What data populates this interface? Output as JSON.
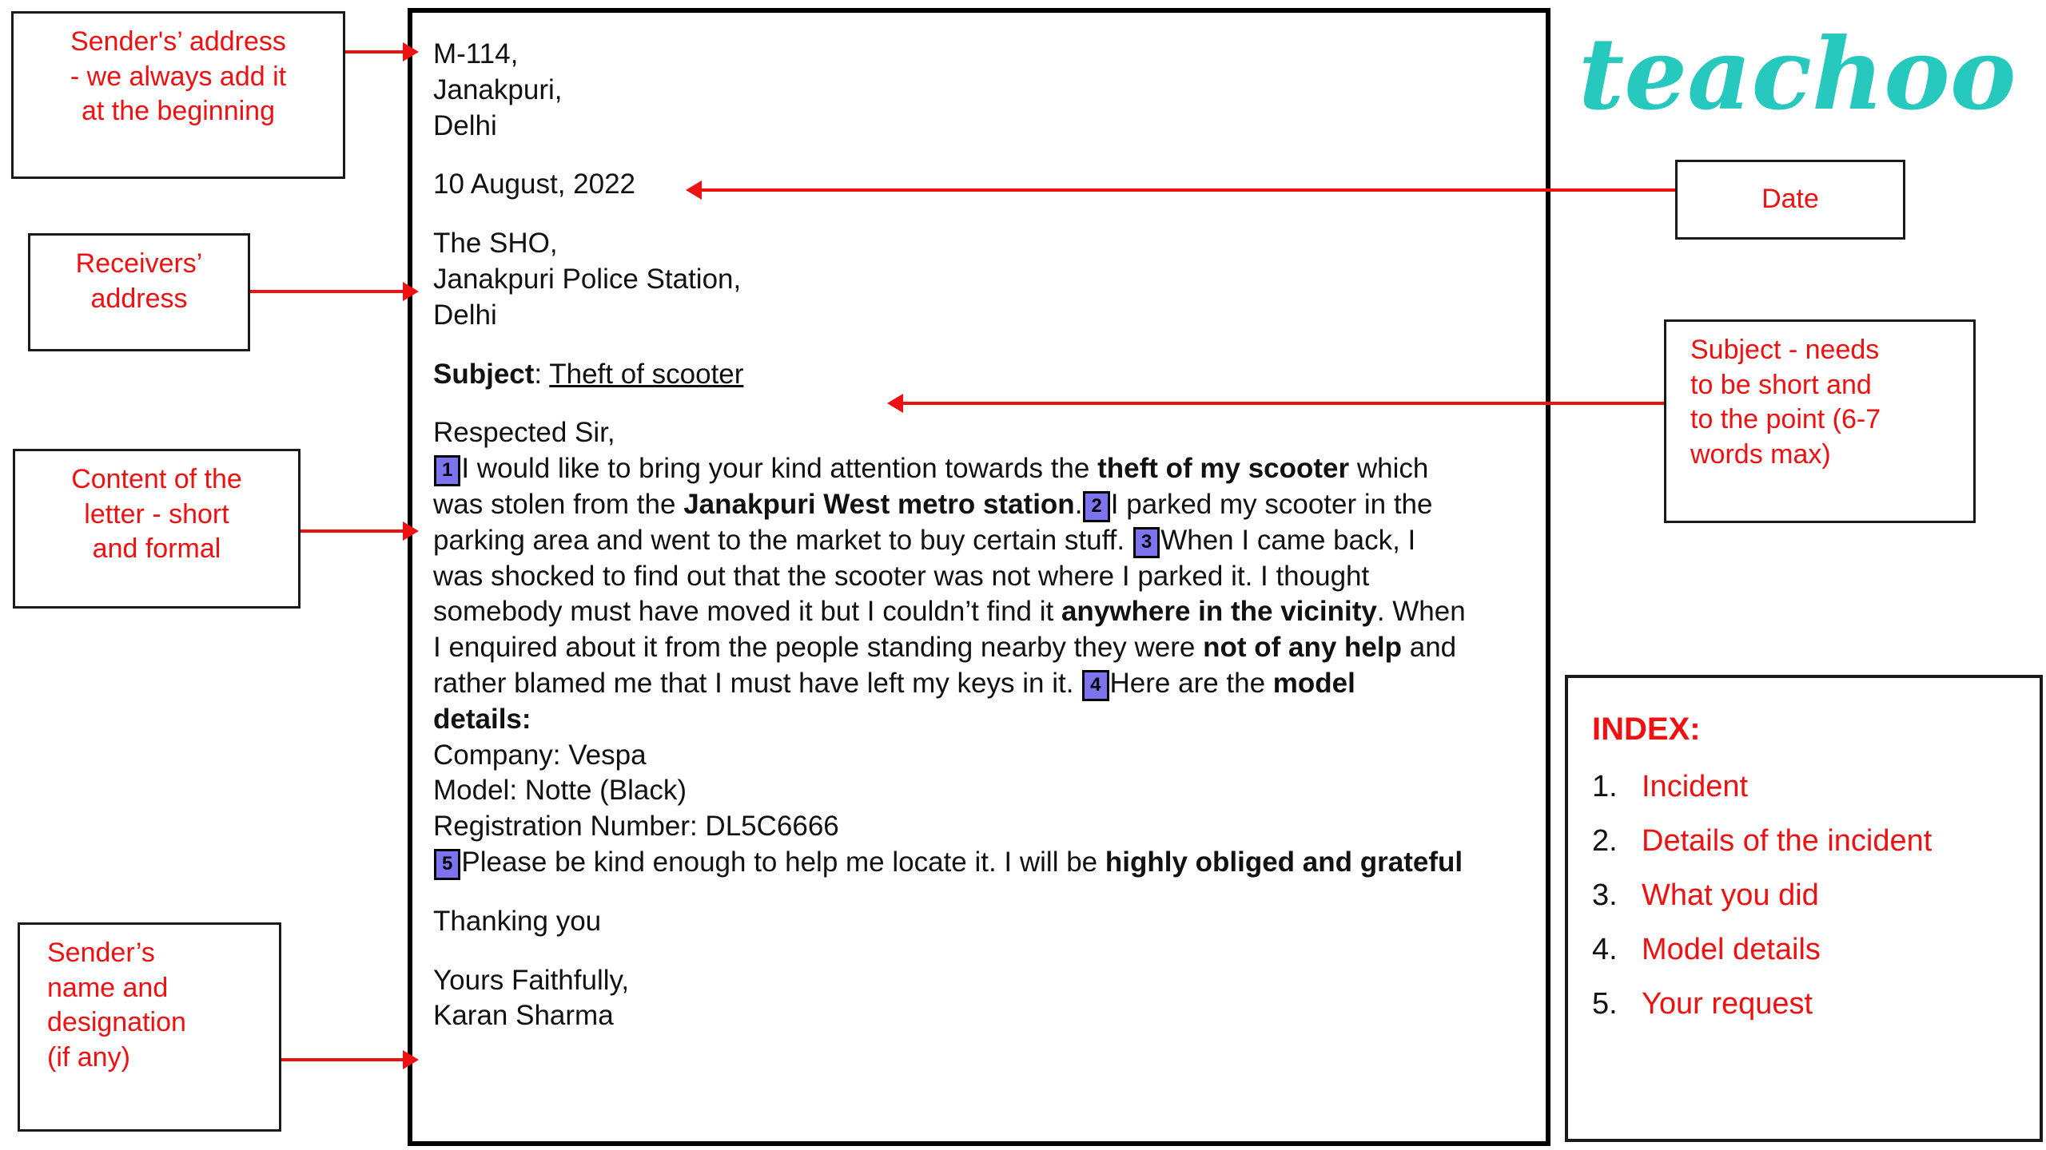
{
  "brand": {
    "logo_text": "teachoo",
    "logo_color": "#27c8bd"
  },
  "colors": {
    "annotation_red": "#ee1111",
    "marker_purple": "#7d73ee",
    "frame_black": "#000000"
  },
  "callouts": {
    "senders_address": "Sender's’ address\n- we always add it\nat the beginning",
    "senders_address_l1": "Sender's’ address",
    "senders_address_l2": "- we always add it",
    "senders_address_l3": "at the beginning",
    "receivers_address_l1": "Receivers’",
    "receivers_address_l2": "address",
    "content_l1": "Content of the",
    "content_l2": "letter - short",
    "content_l3": "and formal",
    "sender_name_l1": "Sender’s",
    "sender_name_l2": "name and",
    "sender_name_l3": "designation",
    "sender_name_l4": "(if any)",
    "date": "Date",
    "subject_l1": "Subject - needs",
    "subject_l2": "to be short and",
    "subject_l3": "to the point (6-7",
    "subject_l4": "words max)"
  },
  "letter": {
    "sender_address": {
      "line1": "M-114,",
      "line2": "Janakpuri,",
      "line3": "Delhi"
    },
    "date": "10 August, 2022",
    "receiver_address": {
      "line1": "The SHO,",
      "line2": "Janakpuri Police Station,",
      "line3": "Delhi"
    },
    "subject_label": "Subject",
    "subject_sep": ": ",
    "subject_value": "Theft of scooter",
    "salutation": "Respected Sir,",
    "body": {
      "m1": "1",
      "p1_a": "I would like to bring your kind attention towards the ",
      "p1_b": "theft of my scooter",
      "p1_c": " which",
      "p2_a": "was stolen from the ",
      "p2_b": "Janakpuri West metro station",
      "p2_c": ".",
      "m2": "2",
      "p2_d": "I parked my scooter in the",
      "p3_a": "parking area and went to the market to buy certain stuff. ",
      "m3": "3",
      "p3_b": "When I came back, I",
      "p4": "was shocked to find out that the scooter was not where I parked it. I thought",
      "p5_a": "somebody must have moved it but I couldn’t find it ",
      "p5_b": "anywhere in the vicinity",
      "p5_c": ". When",
      "p6_a": "I enquired about it from the people standing nearby they were ",
      "p6_b": "not of any help",
      "p6_c": " and",
      "p7_a": "rather blamed me that I must have left my keys in it. ",
      "m4": "4",
      "p7_b": "Here are the ",
      "p7_c": "model",
      "p8": "details:",
      "company": "Company: Vespa",
      "model": "Model: Notte (Black)",
      "registration": "Registration Number: DL5C6666",
      "m5": "5",
      "p9_a": "Please be kind enough to help me locate it. I will be ",
      "p9_b": "highly obliged and grateful"
    },
    "thanking": "Thanking you",
    "closing": "Yours Faithfully,",
    "signature": "Karan Sharma"
  },
  "index": {
    "title": "INDEX:",
    "items": [
      {
        "num": "1.",
        "label": "Incident"
      },
      {
        "num": "2.",
        "label": "Details of the incident"
      },
      {
        "num": "3.",
        "label": "What you did"
      },
      {
        "num": "4.",
        "label": "Model details"
      },
      {
        "num": "5.",
        "label": "Your request"
      }
    ]
  }
}
